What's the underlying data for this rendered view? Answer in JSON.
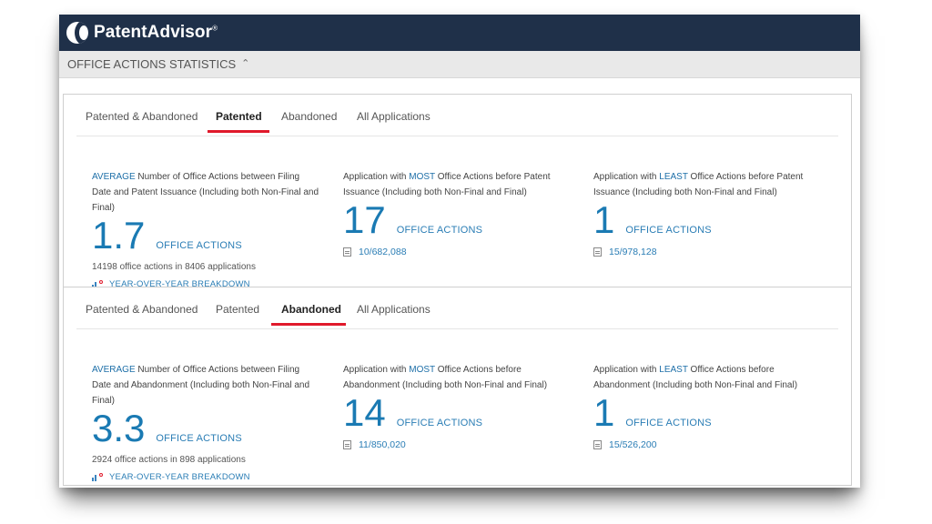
{
  "header": {
    "brand": "PatentAdvisor",
    "trademark": "®"
  },
  "subheader": {
    "title": "OFFICE ACTIONS STATISTICS"
  },
  "panels": [
    {
      "tabs": [
        "Patented & Abandoned",
        "Patented",
        "Abandoned",
        "All Applications"
      ],
      "active_tab": "Patented",
      "stats": [
        {
          "highlight": "AVERAGE",
          "desc": " Number of Office Actions between Filing Date and Patent Issuance (Including both Non-Final and Final)",
          "value": "1.7",
          "unit": "OFFICE ACTIONS",
          "sub": "14198 office actions in 8406 applications",
          "breakdown": "YEAR-OVER-YEAR BREAKDOWN"
        },
        {
          "prefix": "Application with ",
          "highlight": "MOST",
          "desc": " Office Actions before Patent Issuance (Including both Non-Final and Final)",
          "value": "17",
          "unit": "OFFICE ACTIONS",
          "link": "10/682,088"
        },
        {
          "prefix": "Application with ",
          "highlight": "LEAST",
          "desc": " Office Actions before Patent Issuance (Including both Non-Final and Final)",
          "value": "1",
          "unit": "OFFICE ACTIONS",
          "link": "15/978,128"
        }
      ]
    },
    {
      "tabs": [
        "Patented & Abandoned",
        "Patented",
        "Abandoned",
        "All Applications"
      ],
      "active_tab": "Abandoned",
      "stats": [
        {
          "highlight": "AVERAGE",
          "desc": " Number of Office Actions between Filing Date and Abandonment (Including both Non-Final and Final)",
          "value": "3.3",
          "unit": "OFFICE ACTIONS",
          "sub": "2924 office actions in 898 applications",
          "breakdown": "YEAR-OVER-YEAR BREAKDOWN"
        },
        {
          "prefix": "Application with ",
          "highlight": "MOST",
          "desc": " Office Actions before Abandonment (Including both Non-Final and Final)",
          "value": "14",
          "unit": "OFFICE ACTIONS",
          "link": "11/850,020"
        },
        {
          "prefix": "Application with ",
          "highlight": "LEAST",
          "desc": " Office Actions before Abandonment (Including both Non-Final and Final)",
          "value": "1",
          "unit": "OFFICE ACTIONS",
          "link": "15/526,200"
        }
      ]
    }
  ],
  "colors": {
    "navbar": "#1f3049",
    "accent": "#1a7ab3",
    "tab_indicator": "#e0192b"
  },
  "icons": [
    "logo-icon",
    "chevron-up-icon",
    "document-icon",
    "bar-chart-icon"
  ]
}
